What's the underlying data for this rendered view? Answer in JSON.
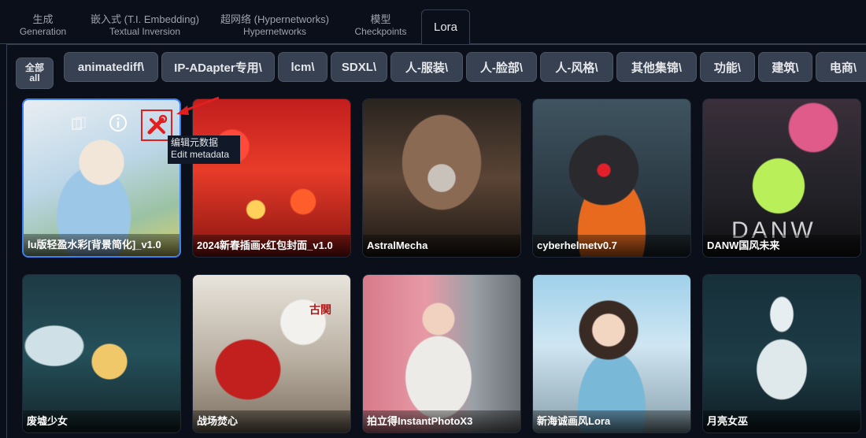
{
  "tabs": [
    {
      "line1": "生成",
      "line2": "Generation"
    },
    {
      "line1": "嵌入式 (T.I. Embedding)",
      "line2": "Textual Inversion"
    },
    {
      "line1": "超网络 (Hypernetworks)",
      "line2": "Hypernetworks"
    },
    {
      "line1": "模型",
      "line2": "Checkpoints"
    },
    {
      "label": "Lora",
      "active": true
    }
  ],
  "filters": {
    "all": {
      "line1": "全部",
      "line2": "all"
    },
    "items": [
      "animatediff\\",
      "IP-ADapter专用\\",
      "lcm\\",
      "SDXL\\",
      "人-服装\\",
      "人-脸部\\",
      "人-风格\\",
      "其他集锦\\",
      "功能\\",
      "建筑\\",
      "电商\\"
    ]
  },
  "cards": [
    {
      "name": "lu版轻盈水彩[背景简化]_v1.0",
      "selected": true
    },
    {
      "name": "2024新春插画x红包封面_v1.0"
    },
    {
      "name": "AstralMecha"
    },
    {
      "name": "cyberhelmetv0.7"
    },
    {
      "name": "DANW国风未来"
    },
    {
      "name": "废墟少女"
    },
    {
      "name": "战场焚心"
    },
    {
      "name": "拍立得InstantPhotoX3"
    },
    {
      "name": "新海诚画风Lora"
    },
    {
      "name": "月亮女巫"
    }
  ],
  "card_overlay_text": {
    "danw": "DANW",
    "flag": "古関"
  },
  "tooltip": {
    "line1": "编辑元数据",
    "line2": "Edit metadata"
  },
  "icons": {
    "copy": "copy-path-icon",
    "info": "info-icon",
    "edit": "edit-metadata-icon",
    "annotation": "red-arrow-annotation"
  },
  "colors": {
    "background": "#0b0f19",
    "chip": "#374151",
    "selected_border": "#3b82f6",
    "annotation": "#e02020"
  }
}
